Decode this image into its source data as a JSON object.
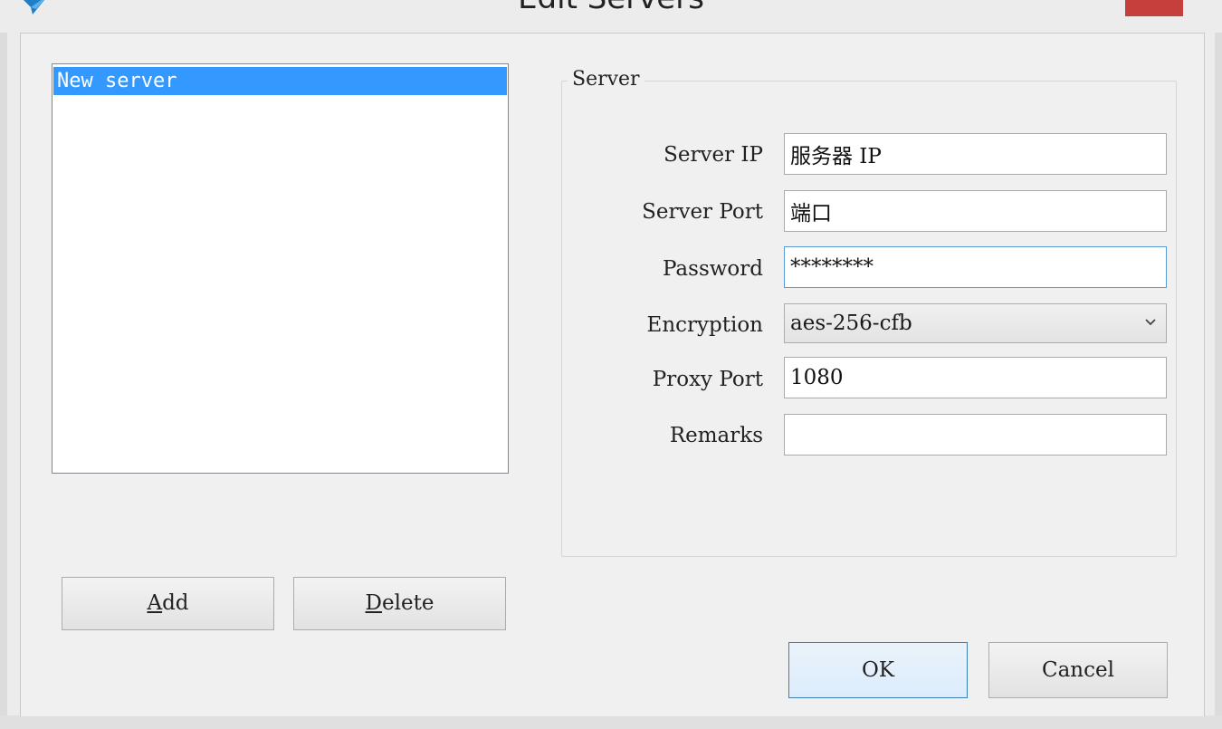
{
  "window": {
    "title": "Edit Servers"
  },
  "server_list": {
    "items": [
      {
        "label": "New server",
        "selected": true
      }
    ]
  },
  "server_group": {
    "title": "Server",
    "fields": {
      "server_ip": {
        "label": "Server IP",
        "value": "服务器 IP"
      },
      "server_port": {
        "label": "Server Port",
        "value": "端口"
      },
      "password": {
        "label": "Password",
        "value": "********"
      },
      "encryption": {
        "label": "Encryption",
        "value": "aes-256-cfb"
      },
      "proxy_port": {
        "label": "Proxy Port",
        "value": "1080"
      },
      "remarks": {
        "label": "Remarks",
        "value": ""
      }
    }
  },
  "buttons": {
    "add": {
      "mnemonic": "A",
      "rest": "dd"
    },
    "delete": {
      "mnemonic": "D",
      "rest": "elete"
    },
    "ok": "OK",
    "cancel": "Cancel"
  },
  "colors": {
    "selection": "#3399ff",
    "close_button": "#c5403c",
    "focus_border": "#5b9bd5"
  },
  "icons": [
    "app-icon",
    "close-icon",
    "chevron-down-icon"
  ]
}
